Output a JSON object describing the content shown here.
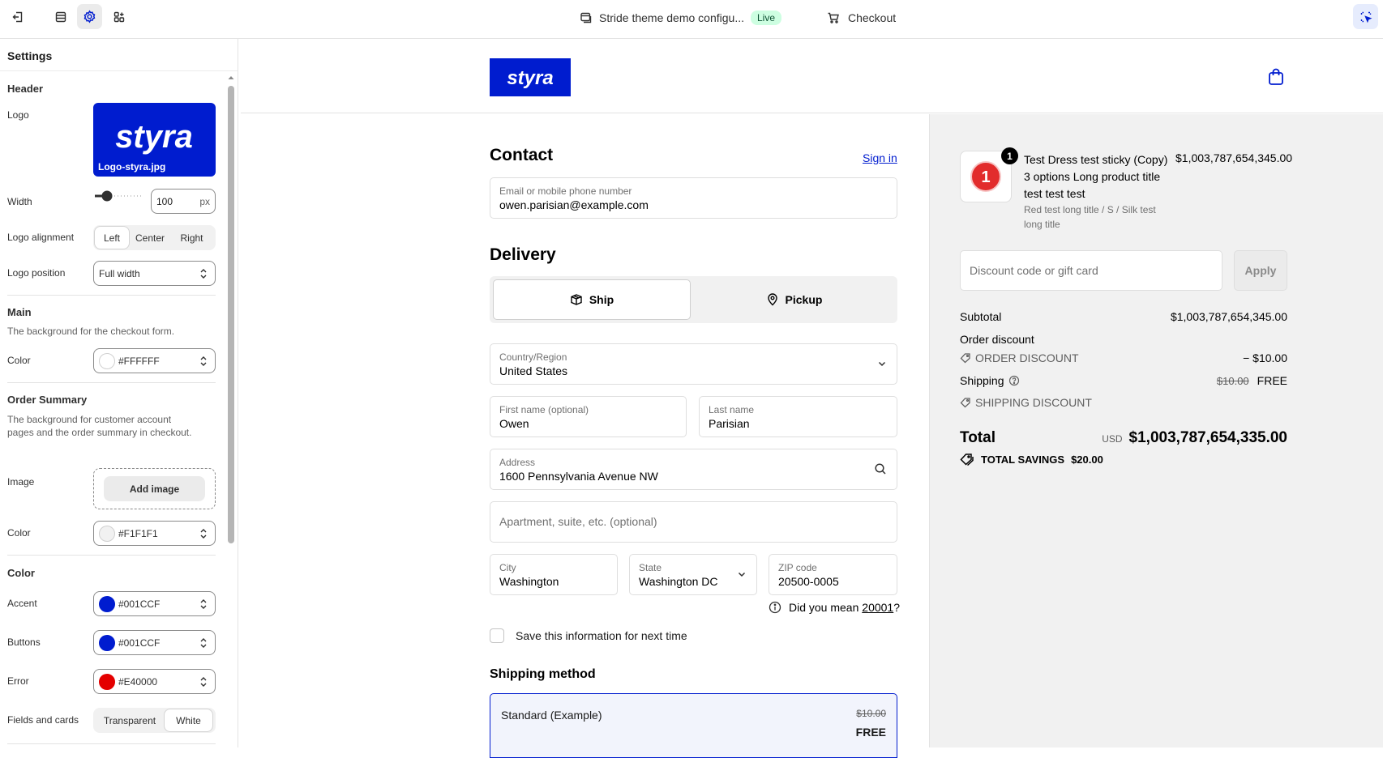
{
  "topbar": {
    "title": "Stride theme demo configu...",
    "live_badge": "Live",
    "checkout_label": "Checkout"
  },
  "settings": {
    "title": "Settings",
    "header": {
      "section": "Header",
      "logo_label": "Logo",
      "logo_filename": "Logo-styra.jpg",
      "width_label": "Width",
      "width_value": "100",
      "width_unit": "px",
      "width_slider_fraction": 0.08,
      "alignment_label": "Logo alignment",
      "alignment_options": [
        "Left",
        "Center",
        "Right"
      ],
      "alignment_selected": "Left",
      "position_label": "Logo position",
      "position_value": "Full width"
    },
    "main": {
      "section": "Main",
      "description": "The background for the checkout form.",
      "color_label": "Color",
      "color_value": "#FFFFFF"
    },
    "order_summary": {
      "section": "Order Summary",
      "description": "The background for customer account pages and the order summary in checkout.",
      "image_label": "Image",
      "add_image": "Add image",
      "color_label": "Color",
      "color_value": "#F1F1F1"
    },
    "color": {
      "section": "Color",
      "accent_label": "Accent",
      "accent_value": "#001CCF",
      "buttons_label": "Buttons",
      "buttons_value": "#001CCF",
      "error_label": "Error",
      "error_value": "#E40000",
      "fields_label": "Fields and cards",
      "fields_options": [
        "Transparent",
        "White"
      ],
      "fields_selected": "White"
    }
  },
  "checkout": {
    "brand": "styra",
    "contact_heading": "Contact",
    "sign_in": "Sign in",
    "email_label": "Email or mobile phone number",
    "email_value": "owen.parisian@example.com",
    "delivery_heading": "Delivery",
    "ship_label": "Ship",
    "pickup_label": "Pickup",
    "country_label": "Country/Region",
    "country_value": "United States",
    "first_name_label": "First name (optional)",
    "first_name_value": "Owen",
    "last_name_label": "Last name",
    "last_name_value": "Parisian",
    "address_label": "Address",
    "address_value": "1600 Pennsylvania Avenue NW",
    "apartment_placeholder": "Apartment, suite, etc. (optional)",
    "city_label": "City",
    "city_value": "Washington",
    "state_label": "State",
    "state_value": "Washington DC",
    "zip_label": "ZIP code",
    "zip_value": "20500-0005",
    "hint_prefix": "Did you mean ",
    "hint_zip": "20001",
    "hint_suffix": "?",
    "save_info": "Save this information for next time",
    "shipping_method_heading": "Shipping method",
    "shipping_option_name": "Standard (Example)",
    "shipping_option_old": "$10.00",
    "shipping_option_price": "FREE"
  },
  "summary": {
    "quantity": "1",
    "product_title": "Test Dress test sticky (Copy) 3 options Long product title test test test",
    "product_variant": "Red test long title / S / Silk test long title",
    "product_price": "$1,003,787,654,345.00",
    "discount_placeholder": "Discount code or gift card",
    "apply": "Apply",
    "subtotal_label": "Subtotal",
    "subtotal_value": "$1,003,787,654,345.00",
    "order_discount_label": "Order discount",
    "order_discount_code": "ORDER DISCOUNT",
    "order_discount_value": "− $10.00",
    "shipping_label": "Shipping",
    "shipping_old": "$10.00",
    "shipping_value": "FREE",
    "shipping_discount_code": "SHIPPING DISCOUNT",
    "total_label": "Total",
    "currency": "USD",
    "total_value": "$1,003,787,654,335.00",
    "savings_label": "TOTAL SAVINGS",
    "savings_value": "$20.00"
  }
}
